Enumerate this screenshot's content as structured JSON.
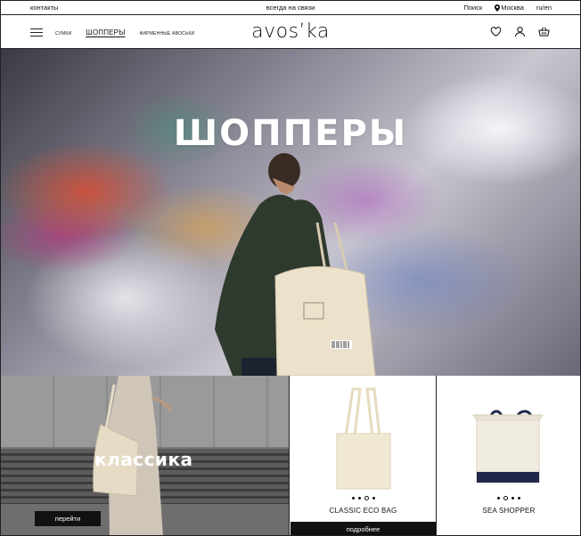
{
  "topbar": {
    "contacts": "контакты",
    "tagline": "всегда на связи",
    "search": "Поиск",
    "city": "Москва",
    "lang": "ru/en"
  },
  "header": {
    "logo": "avos’ka",
    "nav": [
      {
        "label": "сумки",
        "active": false
      },
      {
        "label": "шопперы",
        "active": true
      },
      {
        "label": "фирменные авоськи",
        "active": false
      }
    ],
    "icons": [
      "heart-icon",
      "user-icon",
      "basket-icon"
    ]
  },
  "hero": {
    "title": "ШОППЕРЫ"
  },
  "classic": {
    "title": "классика",
    "button": "перейти"
  },
  "products": [
    {
      "name": "CLASSIC ECO BAG",
      "button": "подробнее",
      "active_dot": 2,
      "dot_count": 4
    },
    {
      "name": "SEA SHOPPER",
      "active_dot": 1,
      "dot_count": 4
    }
  ],
  "colors": {
    "text": "#111111",
    "button_bg": "#111111",
    "button_text": "#ffffff",
    "border": "#222222",
    "bag_natural": "#efe6cf",
    "bag_navy": "#1f2a4a"
  }
}
